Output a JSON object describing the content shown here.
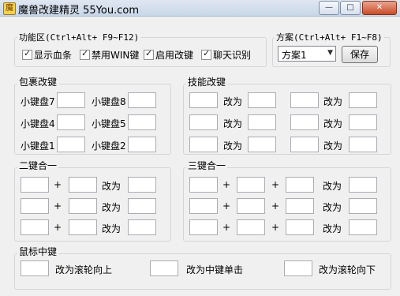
{
  "window": {
    "title": "魔兽改建精灵 55You.com",
    "min_btn": "—",
    "max_btn": "□",
    "close_btn": "✕"
  },
  "functions": {
    "label": "功能区(Ctrl+Alt+ F9~F12)",
    "checkboxes": [
      {
        "label": "显示血条",
        "checked": true
      },
      {
        "label": "禁用WIN键",
        "checked": true
      },
      {
        "label": "启用改键",
        "checked": true
      },
      {
        "label": "聊天识别",
        "checked": true
      }
    ]
  },
  "scheme": {
    "label": "方案(Ctrl+Alt+ F1~F8)",
    "selected": "方案1",
    "save_label": "保存"
  },
  "inventory": {
    "label": "包裹改键",
    "rows": [
      [
        "小键盘7",
        "小键盘8"
      ],
      [
        "小键盘4",
        "小键盘5"
      ],
      [
        "小键盘1",
        "小键盘2"
      ]
    ]
  },
  "skills": {
    "label": "技能改键",
    "change_to": "改为"
  },
  "two_in_one": {
    "label": "二键合一",
    "plus": "+",
    "change_to": "改为"
  },
  "three_in_one": {
    "label": "三键合一",
    "plus": "+",
    "change_to": "改为"
  },
  "mouse": {
    "label": "鼠标中键",
    "options": [
      "改为滚轮向上",
      "改为中键单击",
      "改为滚轮向下"
    ]
  },
  "icon": "app-icon"
}
